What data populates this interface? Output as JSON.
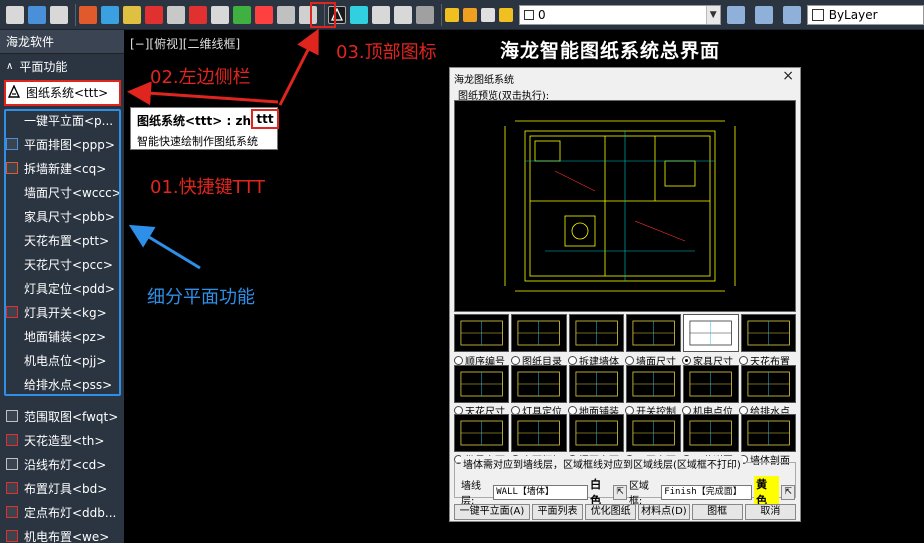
{
  "toolbar": {
    "layer_value": "0",
    "linetype_value": "ByLayer",
    "icons": [
      "open-icon",
      "save-icon",
      "print-icon",
      "layer-off-icon",
      "layer-freeze-icon",
      "layer-lock-icon",
      "layer-state-icon",
      "layer-tool-icon",
      "layer-tool-icon",
      "layer-tool-icon",
      "layer-tool-icon",
      "layer-tool-icon",
      "layer-tool-icon",
      "layer-tool-icon",
      "drawing-system-icon",
      "viewport-icon",
      "layer-manager-icon",
      "layer-props-icon",
      "layer-iso-icon"
    ]
  },
  "sidebar": {
    "header": "海龙软件",
    "section": "平面功能",
    "active_item": "图纸系统<ttt>",
    "items": [
      {
        "label": "一键平立面<p...",
        "icon": ""
      },
      {
        "label": "平面排图<ppp>",
        "icon": "layout-icon"
      },
      {
        "label": "拆墙新建<cq>",
        "icon": "wall-icon"
      },
      {
        "label": "墙面尺寸<wccc>",
        "icon": ""
      },
      {
        "label": "家具尺寸<pbb>",
        "icon": ""
      },
      {
        "label": "天花布置<ptt>",
        "icon": ""
      },
      {
        "label": "天花尺寸<pcc>",
        "icon": ""
      },
      {
        "label": "灯具定位<pdd>",
        "icon": ""
      },
      {
        "label": "灯具开关<kg>",
        "icon": "switch-icon"
      },
      {
        "label": "地面铺装<pz>",
        "icon": ""
      },
      {
        "label": "机电点位<pjj>",
        "icon": ""
      },
      {
        "label": "给排水点<pss>",
        "icon": ""
      }
    ],
    "items_lower": [
      {
        "label": "范围取图<fwqt>",
        "icon": "range-icon"
      },
      {
        "label": "天花造型<th>",
        "icon": "ceiling-icon"
      },
      {
        "label": "沿线布灯<cd>",
        "icon": "line-light-icon"
      },
      {
        "label": "布置灯具<bd>",
        "icon": "light-icon"
      },
      {
        "label": "定点布灯<ddb...",
        "icon": "point-light-icon"
      },
      {
        "label": "机电布置<we>",
        "icon": "electric-icon"
      }
    ]
  },
  "canvas": {
    "view_label": "[−][俯视][二维线框]",
    "tooltip_title": "图纸系统<ttt> : zhl",
    "tooltip_key": "ttt",
    "tooltip_desc": "智能快速绘制作图纸系统",
    "main_title": "海龙智能图纸系统总界面"
  },
  "annotations": {
    "top_icon": "03.顶部图标",
    "left_sidebar": "02.左边侧栏",
    "shortcut": "01.快捷键TTT",
    "sub_functions": "细分平面功能"
  },
  "dialog": {
    "title": "海龙图纸系统",
    "close": "×",
    "preview_label": "图纸预览(双击执行):",
    "row1_options": [
      "顺序编号",
      "图纸目录",
      "拆建墙体",
      "墙面尺寸",
      "家具尺寸",
      "天花布置"
    ],
    "row1_selected": 4,
    "row2_options": [
      "天花尺寸",
      "灯具定位",
      "地面铺装",
      "开关控制",
      "机电点位",
      "给排水点"
    ],
    "row3_options": [
      "批量立面",
      "立面框架",
      "门页立面",
      "平开立面",
      "天花详图",
      "墙体剖面"
    ],
    "group_title": "墙体需对应到墙线层，区域框线对应到区域线层(区域框不打印)",
    "wall_layer_label": "墙线层:",
    "wall_layer_value": "WALL【墙体】",
    "wall_color": "白色",
    "region_label": "区域框:",
    "region_value": "Finish【完成面】",
    "region_color": "黄色",
    "buttons": [
      "一键平立面(A)",
      "平面列表",
      "优化图纸",
      "材料点(D)",
      "图框",
      "取消"
    ]
  },
  "colors": {
    "toolbar_bg": "#2b3441",
    "sidebar_bg": "#2b3441",
    "annotation_red": "#e0251f",
    "annotation_blue": "#2e8fe8",
    "cad_yellow": "#ffff00"
  }
}
